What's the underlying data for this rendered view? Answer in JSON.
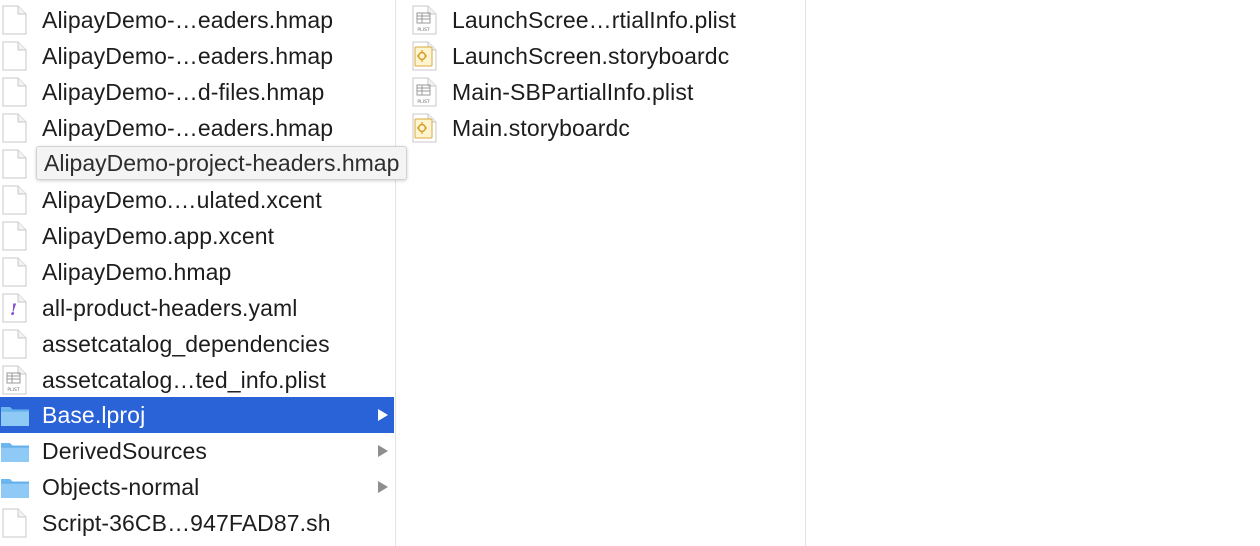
{
  "columns": [
    {
      "items": [
        {
          "label": "AlipayDemo-…eaders.hmap",
          "icon": "document-icon"
        },
        {
          "label": "AlipayDemo-…eaders.hmap",
          "icon": "document-icon"
        },
        {
          "label": "AlipayDemo-…d-files.hmap",
          "icon": "document-icon"
        },
        {
          "label": "AlipayDemo-…eaders.hmap",
          "icon": "document-icon"
        },
        {
          "label": "",
          "icon": "document-icon"
        },
        {
          "label": "AlipayDemo.…ulated.xcent",
          "icon": "document-icon"
        },
        {
          "label": "AlipayDemo.app.xcent",
          "icon": "document-icon"
        },
        {
          "label": "AlipayDemo.hmap",
          "icon": "document-icon"
        },
        {
          "label": "all-product-headers.yaml",
          "icon": "yaml-icon"
        },
        {
          "label": "assetcatalog_dependencies",
          "icon": "document-icon"
        },
        {
          "label": "assetcatalog…ted_info.plist",
          "icon": "plist-icon"
        },
        {
          "label": "Base.lproj",
          "icon": "folder-icon",
          "folder": true,
          "selected": true
        },
        {
          "label": "DerivedSources",
          "icon": "folder-icon",
          "folder": true
        },
        {
          "label": "Objects-normal",
          "icon": "folder-icon",
          "folder": true
        },
        {
          "label": "Script-36CB…947FAD87.sh",
          "icon": "document-icon"
        }
      ]
    },
    {
      "items": [
        {
          "label": "LaunchScree…rtialInfo.plist",
          "icon": "plist-icon"
        },
        {
          "label": "LaunchScreen.storyboardc",
          "icon": "storyboard-icon"
        },
        {
          "label": "Main-SBPartialInfo.plist",
          "icon": "plist-icon"
        },
        {
          "label": "Main.storyboardc",
          "icon": "storyboard-icon"
        }
      ]
    }
  ],
  "tooltip": {
    "text": "AlipayDemo-project-headers.hmap"
  },
  "icon_badges": {
    "plist": "PLIST",
    "yaml": "!"
  },
  "colors": {
    "selection": "#2a62d8",
    "folder": "#6cb7f0"
  }
}
